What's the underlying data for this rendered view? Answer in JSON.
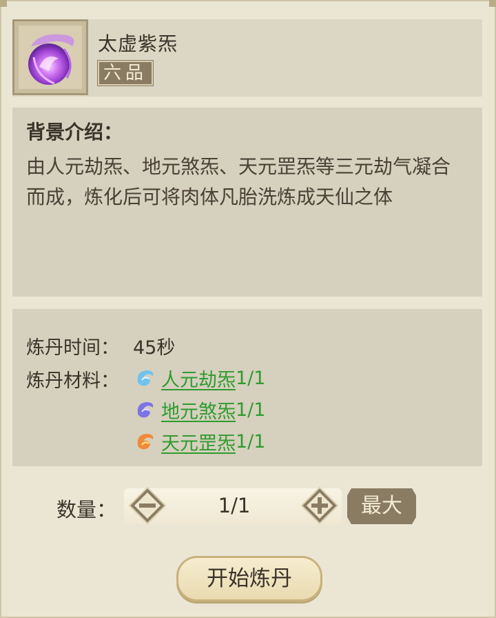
{
  "item": {
    "name": "太虚紫炁",
    "grade": "六品"
  },
  "description": {
    "title": "背景介绍：",
    "body": "由人元劫炁、地元煞炁、天元罡炁等三元劫气凝合而成，炼化后可将肉体凡胎洗炼成天仙之体"
  },
  "refine": {
    "time_label": "炼丹时间：",
    "time_value": "45秒",
    "materials_label": "炼丹材料：",
    "materials": [
      {
        "name": "人元劫炁",
        "count": "1/1",
        "icon": "blue-qi-icon"
      },
      {
        "name": "地元煞炁",
        "count": "1/1",
        "icon": "purple-qi-icon"
      },
      {
        "name": "天元罡炁",
        "count": "1/1",
        "icon": "fire-qi-icon"
      }
    ]
  },
  "quantity": {
    "label": "数量：",
    "value": "1/1",
    "max_label": "最大"
  },
  "start_button": "开始炼丹",
  "colors": {
    "accent_green": "#2e9b2e",
    "panel": "#d6d0be",
    "badge": "#8a7c63"
  }
}
